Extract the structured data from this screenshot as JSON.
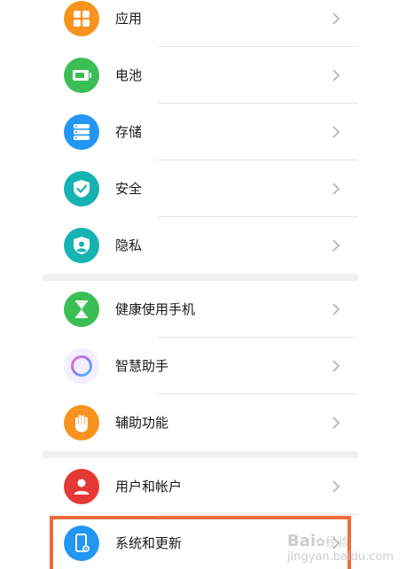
{
  "settings": {
    "items": [
      {
        "label": "应用",
        "icon": "apps-grid-icon",
        "color": "#f7931e"
      },
      {
        "label": "电池",
        "icon": "battery-icon",
        "color": "#3bbf55"
      },
      {
        "label": "存储",
        "icon": "storage-icon",
        "color": "#2196f3"
      },
      {
        "label": "安全",
        "icon": "shield-check-icon",
        "color": "#17b3b3"
      },
      {
        "label": "隐私",
        "icon": "privacy-shield-icon",
        "color": "#17b3b3"
      },
      {
        "label": "健康使用手机",
        "icon": "hourglass-icon",
        "color": "#3bbf55"
      },
      {
        "label": "智慧助手",
        "icon": "smart-assistant-ring-icon",
        "color": "#9b7bff"
      },
      {
        "label": "辅助功能",
        "icon": "hand-icon",
        "color": "#f7931e"
      },
      {
        "label": "用户和帐户",
        "icon": "user-icon",
        "color": "#e53935"
      },
      {
        "label": "系统和更新",
        "icon": "phone-gear-icon",
        "color": "#2196f3"
      }
    ]
  },
  "watermark": {
    "brand": "Bai",
    "brand_suffix": "经验",
    "url": "jingyan.baidu.com"
  },
  "colors": {
    "highlight": "#f26b3a",
    "divider": "#e6e6e6",
    "section_gap": "#f1f1f1"
  }
}
